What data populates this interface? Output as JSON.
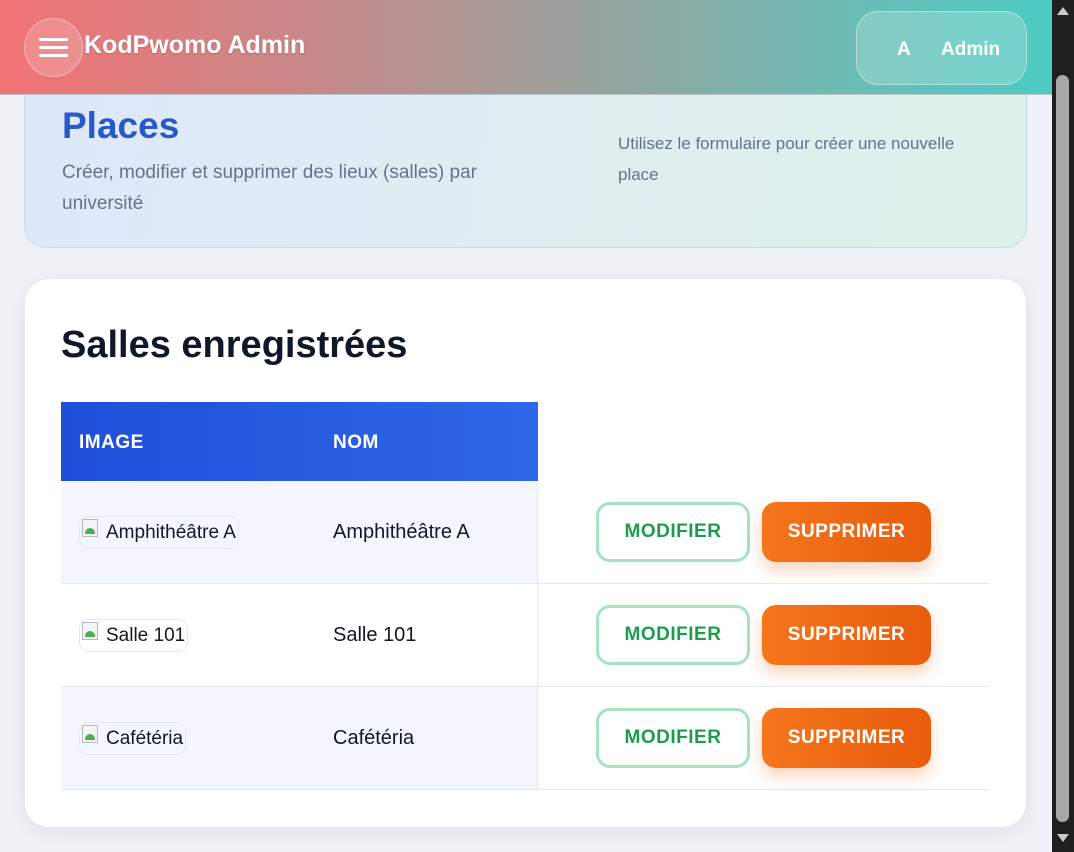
{
  "header": {
    "brand": "KodPwomo Admin",
    "user_initial": "A",
    "user_name": "Admin"
  },
  "hero": {
    "title": "Places",
    "subtitle": "Créer, modifier et supprimer des lieux (salles) par université",
    "hint": "Utilisez le formulaire pour créer une nouvelle place"
  },
  "table": {
    "title": "Salles enregistrées",
    "columns": [
      "IMAGE",
      "NOM"
    ],
    "edit_label": "MODIFIER",
    "delete_label": "SUPPRIMER",
    "rows": [
      {
        "image_alt": "Amphithéâtre A",
        "name": "Amphithéâtre A"
      },
      {
        "image_alt": "Salle 101",
        "name": "Salle 101"
      },
      {
        "image_alt": "Cafétéria",
        "name": "Cafétéria"
      }
    ]
  },
  "colors": {
    "header_start": "#f17374",
    "header_end": "#4ccbc2",
    "primary": "#2a57c9",
    "table_header": "#1f4fd8",
    "edit_green": "#1e9c4d",
    "delete_orange": "#f4761c"
  },
  "icons": {
    "menu": "hamburger-menu-icon",
    "image_placeholder": "broken-image-icon"
  }
}
